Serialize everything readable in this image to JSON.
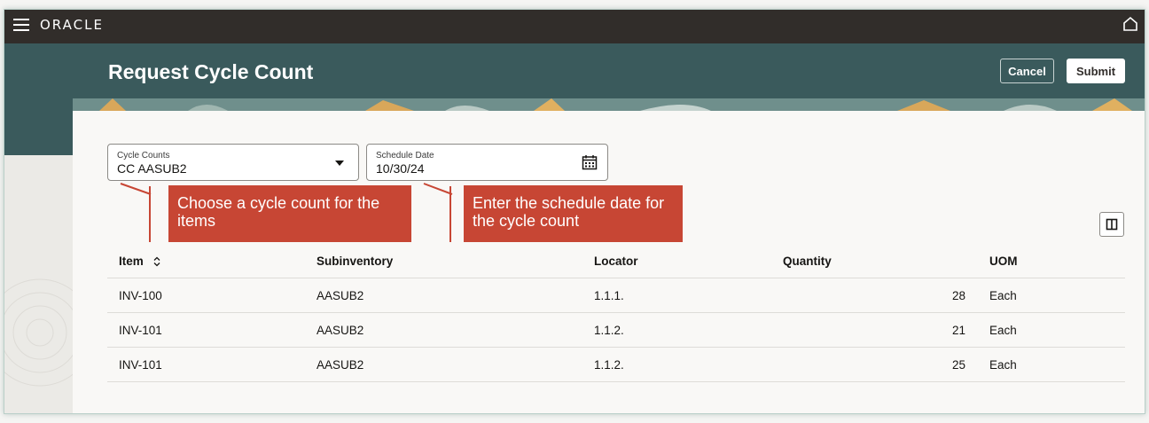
{
  "app": {
    "brand": "ORACLE"
  },
  "page": {
    "title": "Request Cycle Count"
  },
  "actions": {
    "cancel_label": "Cancel",
    "submit_label": "Submit"
  },
  "form": {
    "cycle_counts": {
      "label": "Cycle Counts",
      "value": "CC AASUB2"
    },
    "schedule_date": {
      "label": "Schedule Date",
      "value": "10/30/24"
    }
  },
  "callouts": [
    {
      "text": "Choose a cycle count for the items"
    },
    {
      "text": "Enter the schedule date for the cycle count"
    }
  ],
  "table": {
    "columns": [
      "Item",
      "Subinventory",
      "Locator",
      "Quantity",
      "UOM"
    ],
    "rows": [
      [
        "INV-100",
        "AASUB2",
        "1.1.1.",
        "28",
        "Each"
      ],
      [
        "INV-101",
        "AASUB2",
        "1.1.2.",
        "21",
        "Each"
      ],
      [
        "INV-101",
        "AASUB2",
        "1.1.2.",
        "25",
        "Each"
      ]
    ]
  },
  "colors": {
    "topbar": "#312d2a",
    "header": "#3a5a5c",
    "callout": "#c74634"
  },
  "icons": [
    "hamburger-icon",
    "home-icon",
    "chevron-down-icon",
    "calendar-icon",
    "sort-icon",
    "columns-icon"
  ]
}
